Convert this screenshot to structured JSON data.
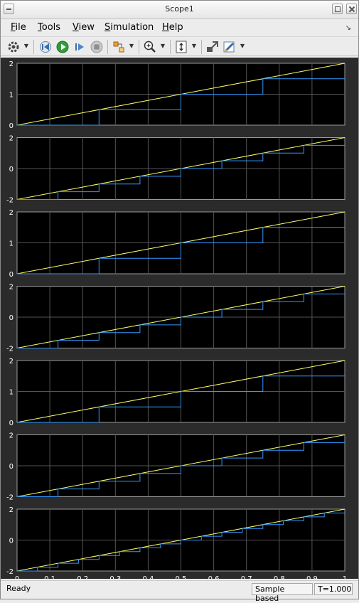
{
  "window": {
    "title": "Scope1"
  },
  "menu": [
    {
      "mnemonic": "F",
      "rest": "ile"
    },
    {
      "mnemonic": "T",
      "rest": "ools"
    },
    {
      "mnemonic": "V",
      "rest": "iew"
    },
    {
      "mnemonic": "S",
      "rest": "imulation"
    },
    {
      "mnemonic": "H",
      "rest": "elp"
    }
  ],
  "toolbar": {
    "items": [
      "settings-icon",
      "step-back-icon",
      "run-icon",
      "step-forward-icon",
      "stop-icon",
      "signal-selector-icon",
      "zoom-in-icon",
      "autoscale-icon",
      "highlight-block-icon",
      "style-icon"
    ]
  },
  "status": {
    "ready": "Ready",
    "mode": "Sample based",
    "time": "T=1.000"
  },
  "colors": {
    "ramp": "#ffff66",
    "stairs": "#3399ff",
    "axes_bg": "#000000",
    "figure_bg": "#2b2b2b",
    "grid": "#555555",
    "tick_text": "#ffffff"
  },
  "chart_data": [
    {
      "type": "line",
      "ylim": [
        0,
        2
      ],
      "yticks": [
        "0",
        "1",
        "2"
      ],
      "xlim": [
        0,
        1
      ],
      "grid": true,
      "series": [
        {
          "values": [
            [
              0,
              0
            ],
            [
              1,
              2
            ]
          ]
        },
        {
          "step": true,
          "values": [
            [
              0,
              0
            ],
            [
              0.25,
              0.5
            ],
            [
              0.5,
              1.0
            ],
            [
              0.75,
              1.5
            ],
            [
              1.0,
              1.5
            ]
          ]
        }
      ]
    },
    {
      "type": "line",
      "ylim": [
        -2,
        2
      ],
      "yticks": [
        "-2",
        "0",
        "2"
      ],
      "xlim": [
        0,
        1
      ],
      "grid": true,
      "series": [
        {
          "values": [
            [
              0,
              -2
            ],
            [
              1,
              2
            ]
          ]
        },
        {
          "step": true,
          "values": [
            [
              0,
              -2
            ],
            [
              0.125,
              -1.5
            ],
            [
              0.25,
              -1.0
            ],
            [
              0.375,
              -0.5
            ],
            [
              0.5,
              0.0
            ],
            [
              0.625,
              0.5
            ],
            [
              0.75,
              1.0
            ],
            [
              0.875,
              1.5
            ],
            [
              1.0,
              1.5
            ]
          ]
        }
      ]
    },
    {
      "type": "line",
      "ylim": [
        0,
        2
      ],
      "yticks": [
        "0",
        "1",
        "2"
      ],
      "xlim": [
        0,
        1
      ],
      "grid": true,
      "series": [
        {
          "values": [
            [
              0,
              0
            ],
            [
              1,
              2
            ]
          ]
        },
        {
          "step": true,
          "values": [
            [
              0,
              0
            ],
            [
              0.25,
              0.5
            ],
            [
              0.5,
              1.0
            ],
            [
              0.75,
              1.5
            ],
            [
              1.0,
              1.5
            ]
          ]
        }
      ]
    },
    {
      "type": "line",
      "ylim": [
        -2,
        2
      ],
      "yticks": [
        "-2",
        "0",
        "2"
      ],
      "xlim": [
        0,
        1
      ],
      "grid": true,
      "series": [
        {
          "values": [
            [
              0,
              -2
            ],
            [
              1,
              2
            ]
          ]
        },
        {
          "step": true,
          "values": [
            [
              0,
              -2
            ],
            [
              0.125,
              -1.5
            ],
            [
              0.25,
              -1.0
            ],
            [
              0.375,
              -0.5
            ],
            [
              0.5,
              0.0
            ],
            [
              0.625,
              0.5
            ],
            [
              0.75,
              1.0
            ],
            [
              0.875,
              1.5
            ],
            [
              1.0,
              1.5
            ]
          ]
        }
      ]
    },
    {
      "type": "line",
      "ylim": [
        0,
        2
      ],
      "yticks": [
        "0",
        "1",
        "2"
      ],
      "xlim": [
        0,
        1
      ],
      "grid": true,
      "series": [
        {
          "values": [
            [
              0,
              0
            ],
            [
              1,
              2
            ]
          ]
        },
        {
          "step": true,
          "values": [
            [
              0,
              0
            ],
            [
              0.25,
              0.5
            ],
            [
              0.5,
              1.0
            ],
            [
              0.75,
              1.5
            ],
            [
              1.0,
              1.5
            ]
          ]
        }
      ]
    },
    {
      "type": "line",
      "ylim": [
        -2,
        2
      ],
      "yticks": [
        "-2",
        "0",
        "2"
      ],
      "xlim": [
        0,
        1
      ],
      "grid": true,
      "series": [
        {
          "values": [
            [
              0,
              -2
            ],
            [
              1,
              2
            ]
          ]
        },
        {
          "step": true,
          "values": [
            [
              0,
              -2
            ],
            [
              0.125,
              -1.5
            ],
            [
              0.25,
              -1.0
            ],
            [
              0.375,
              -0.5
            ],
            [
              0.5,
              0.0
            ],
            [
              0.625,
              0.5
            ],
            [
              0.75,
              1.0
            ],
            [
              0.875,
              1.5
            ],
            [
              1.0,
              1.5
            ]
          ]
        }
      ]
    },
    {
      "type": "line",
      "ylim": [
        -2,
        2
      ],
      "yticks": [
        "-2",
        "0",
        "2"
      ],
      "xlim": [
        0,
        1
      ],
      "xticks": [
        "0",
        "0.1",
        "0.2",
        "0.3",
        "0.4",
        "0.5",
        "0.6",
        "0.7",
        "0.8",
        "0.9",
        "1"
      ],
      "grid": true,
      "series": [
        {
          "values": [
            [
              0,
              -2
            ],
            [
              1,
              2
            ]
          ]
        },
        {
          "step": true,
          "values": [
            [
              0,
              -2
            ],
            [
              0.0625,
              -1.75
            ],
            [
              0.125,
              -1.5
            ],
            [
              0.1875,
              -1.25
            ],
            [
              0.25,
              -1.0
            ],
            [
              0.3125,
              -0.75
            ],
            [
              0.375,
              -0.5
            ],
            [
              0.4375,
              -0.25
            ],
            [
              0.5,
              0.0
            ],
            [
              0.5625,
              0.25
            ],
            [
              0.625,
              0.5
            ],
            [
              0.6875,
              0.75
            ],
            [
              0.75,
              1.0
            ],
            [
              0.8125,
              1.25
            ],
            [
              0.875,
              1.5
            ],
            [
              0.9375,
              1.75
            ],
            [
              1.0,
              1.75
            ]
          ]
        }
      ]
    }
  ]
}
